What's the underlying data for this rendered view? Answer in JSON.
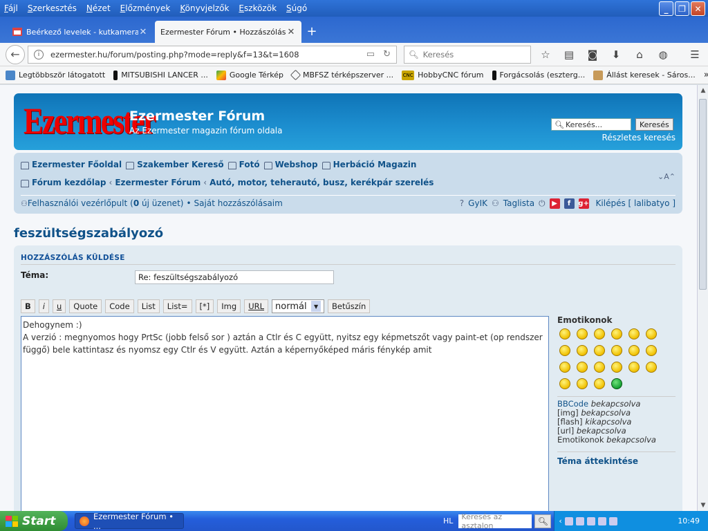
{
  "menubar": {
    "items": [
      "Fájl",
      "Szerkesztés",
      "Nézet",
      "Előzmények",
      "Könyvjelzők",
      "Eszközök",
      "Súgó"
    ]
  },
  "tabs": [
    {
      "title": "Beérkező levelek - kutkamera...",
      "active": false
    },
    {
      "title": "Ezermester Fórum • Hozzászólás k...",
      "active": true
    }
  ],
  "navbar": {
    "url": "ezermester.hu/forum/posting.php?mode=reply&f=13&t=1608",
    "search_placeholder": "Keresés"
  },
  "bookmarks": [
    {
      "label": "Legtöbbször látogatott",
      "icon": "page-icon"
    },
    {
      "label": "MITSUBISHI LANCER ...",
      "icon": "bookmark-icon"
    },
    {
      "label": "Google Térkép",
      "icon": "maps-icon"
    },
    {
      "label": "MBFSZ térképszerver ...",
      "icon": "compass-icon"
    },
    {
      "label": "HobbyCNC fórum",
      "icon": "cnc-icon",
      "badge": "CNC"
    },
    {
      "label": "Forgácsolás (eszterg...",
      "icon": "bookmark-icon"
    },
    {
      "label": "Állást keresek - Sáros...",
      "icon": "box-icon"
    }
  ],
  "forum": {
    "logo_text": "Ezermester",
    "site_title": "Ezermester Fórum",
    "site_description": "Az Ezermester magazin fórum oldala",
    "search_placeholder": "Keresés...",
    "search_button": "Keresés",
    "advanced_search": "Részletes keresés",
    "quick_links": [
      "Ezermester Főoldal",
      "Szakember Kereső",
      "Fotó",
      "Webshop",
      "Herbáció Magazin"
    ],
    "breadcrumb": [
      "Fórum kezdőlap",
      "Ezermester Fórum",
      "Autó, motor, teherautó, busz, kerékpár szerelés"
    ],
    "font_size_control": "A",
    "user_panel": "Felhasználói vezérlőpult",
    "new_messages_pre": "(",
    "new_messages_count": "0",
    "new_messages_post": " új üzenet)",
    "own_posts": "Saját hozzászólásaim",
    "faq": "GyIK",
    "members": "Taglista",
    "logout": "Kilépés [ lalibatyo ]"
  },
  "post": {
    "page_title": "feszültségszabályozó",
    "panel_heading": "HOZZÁSZÓLÁS KÜLDÉSE",
    "subject_label": "Téma:",
    "subject_value": "Re: feszültségszabályozó",
    "format_buttons": [
      "B",
      "i",
      "u",
      "Quote",
      "Code",
      "List",
      "List=",
      "[*]",
      "Img",
      "URL"
    ],
    "font_size_value": "normál",
    "font_color_button": "Betűszín",
    "message_line1": "Dehogynem :)",
    "message_line2": "A verzió : megnyomos hogy PrtSc (jobb felső sor ) aztán a Ctlr és C együtt, nyitsz egy képmetszőt vagy paint-et (op rendszer",
    "message_line3": "függő) bele kattintasz és nyomsz egy Ctlr és V együtt. Aztán a képernyőképed máris fénykép amit",
    "emoticons_heading": "Emotikonok",
    "emoticon_count": 22,
    "options": [
      {
        "label": "BBCode",
        "state": "bekapcsolva"
      },
      {
        "label": "[img]",
        "state": "bekapcsolva"
      },
      {
        "label": "[flash]",
        "state": "kikapcsolva"
      },
      {
        "label": "[url]",
        "state": "bekapcsolva"
      },
      {
        "label": "Emotikonok",
        "state": "bekapcsolva"
      }
    ],
    "topic_review": "Téma áttekintése"
  },
  "taskbar": {
    "start_label": "Start",
    "task_title": "Ezermester Fórum • ...",
    "lang": "HL",
    "search_placeholder": "Keresés az asztalon",
    "clock": "10:49"
  }
}
